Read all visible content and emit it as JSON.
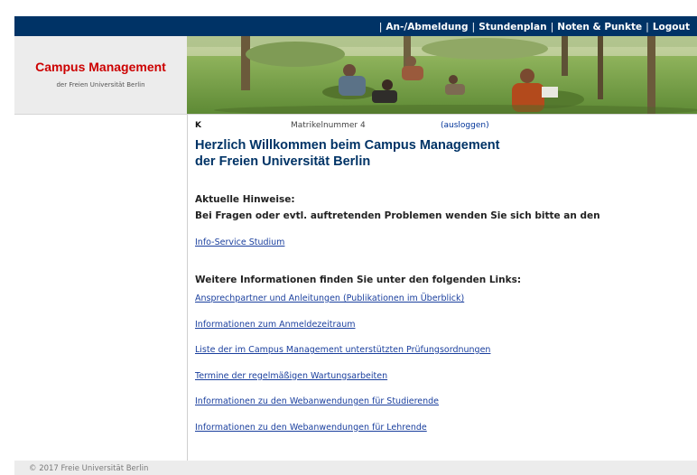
{
  "header": {
    "brand_title": "Campus Management",
    "brand_subtitle": "der Freien Universität Berlin"
  },
  "nav": {
    "items": [
      {
        "label": "An-/Abmeldung"
      },
      {
        "label": "Stundenplan"
      },
      {
        "label": "Noten & Punkte"
      },
      {
        "label": "Logout"
      }
    ]
  },
  "user": {
    "name": "K",
    "matrikel": "Matrikelnummer 4",
    "logout_link": "(ausloggen)"
  },
  "welcome": {
    "line1": "Herzlich Willkommen beim Campus Management",
    "line2": "der Freien Universität Berlin"
  },
  "notices": {
    "heading": "Aktuelle Hinweise:",
    "text": "Bei Fragen oder evtl. auftretenden Problemen wenden Sie sich bitte an den",
    "info_link": "Info-Service Studium"
  },
  "more": {
    "heading": "Weitere Informationen finden Sie unter den folgenden Links:",
    "links": [
      "Ansprechpartner und Anleitungen (Publikationen im Überblick)",
      "Informationen zum Anmeldezeitraum",
      "Liste der im Campus Management unterstützten Prüfungsordnungen",
      "Termine der regelmäßigen Wartungsarbeiten",
      "Informationen zu den Webanwendungen für Studierende",
      "Informationen zu den Webanwendungen für Lehrende"
    ]
  },
  "footer": {
    "text": "© 2017 Freie Universität Berlin"
  },
  "colors": {
    "nav_bg": "#003366",
    "brand_red": "#cc0000",
    "link_blue": "#1a3f9e"
  }
}
